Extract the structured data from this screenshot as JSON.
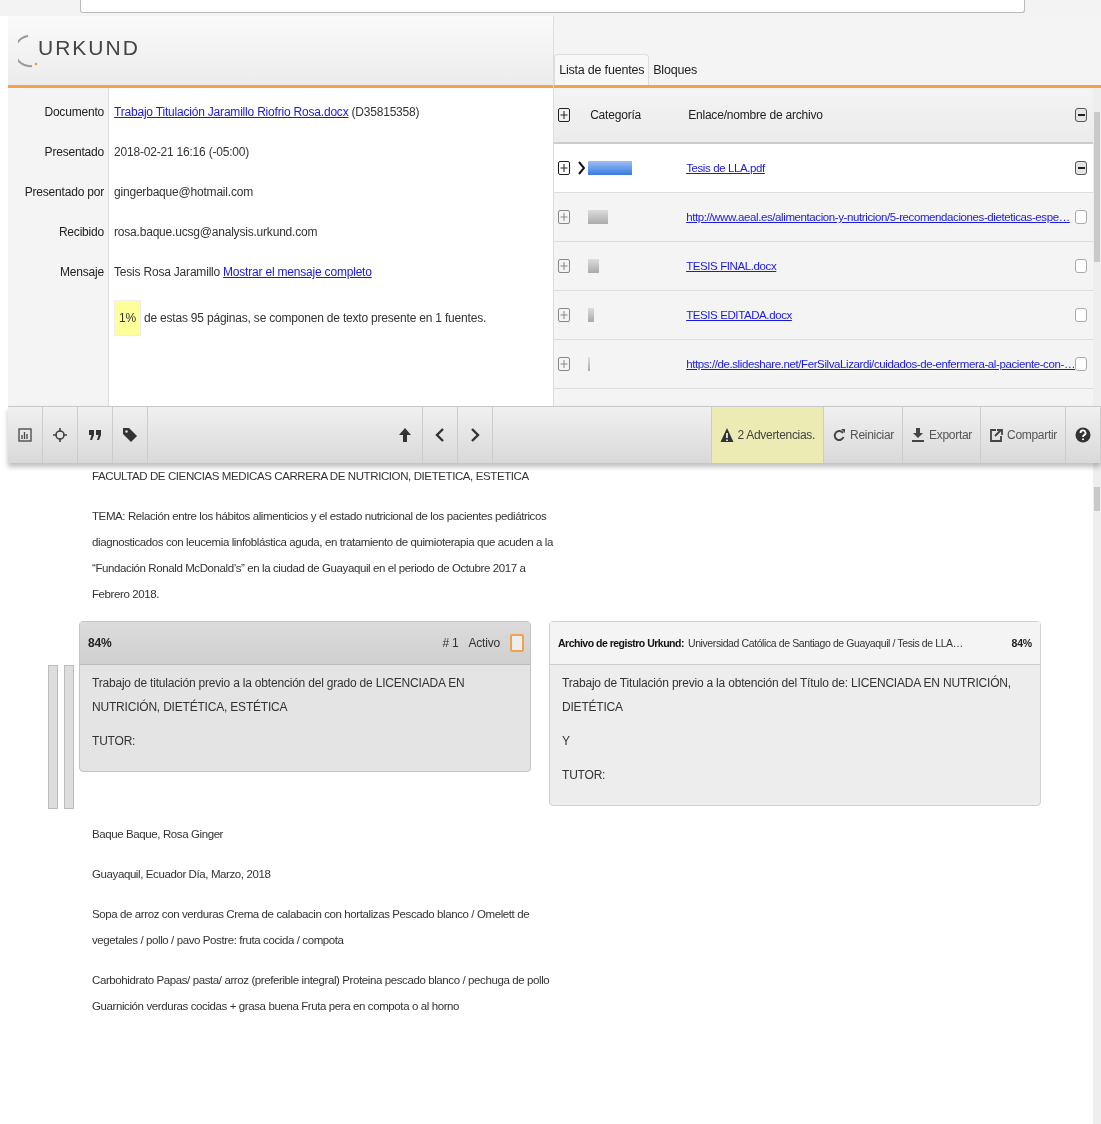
{
  "logo": {
    "text": "URKUND"
  },
  "details": [
    {
      "label": "Documento",
      "kind": "link",
      "value": "Trabajo Titulación Jaramillo Riofrio Rosa.docx",
      "suffix": "(D35815358)"
    },
    {
      "label": "Presentado",
      "kind": "text",
      "value": "2018-02-21 16:16 (-05:00)"
    },
    {
      "label": "Presentado por",
      "kind": "text",
      "value": "gingerbaque@hotmail.com"
    },
    {
      "label": "Recibido",
      "kind": "text",
      "value": "rosa.baque.ucsg@analysis.urkund.com"
    },
    {
      "label": "Mensaje",
      "kind": "message",
      "value": "Tesis Rosa Jaramillo",
      "link": "Mostrar el mensaje completo"
    }
  ],
  "summary": {
    "percent": "1%",
    "text": "de estas 95 páginas, se componen de texto presente en 1 fuentes."
  },
  "tabs": [
    {
      "label": "Lista de fuentes",
      "selected": true
    },
    {
      "label": "Bloques",
      "selected": false
    }
  ],
  "sources": {
    "columns": [
      "Categoría",
      "Enlace/nombre de archivo"
    ],
    "rows": [
      {
        "selected": true,
        "link": "Tesis de LLA.pdf",
        "included": true
      },
      {
        "selected": false,
        "link": "http://www.aeal.es/alimentacion-y-nutricion/5-recomendaciones-dieteticas-espe…",
        "included": false
      },
      {
        "selected": false,
        "link": "TESIS FINAL.docx",
        "included": false
      },
      {
        "selected": false,
        "link": "TESIS EDITADA.docx",
        "included": false
      },
      {
        "selected": false,
        "link": "https://de.slideshare.net/FerSilvaLizardi/cuidados-de-enfermera-al-paciente-con-…",
        "included": false
      }
    ]
  },
  "toolbar": {
    "warnings": "2 Advertencias.",
    "actions": [
      "Reiniciar",
      "Exportar",
      "Compartir"
    ]
  },
  "document": {
    "before": [
      "FACULTAD DE CIENCIAS MEDICAS CARRERA DE NUTRICION, DIETETICA, ESTETICA",
      "TEMA: Relación entre los hábitos alimenticios y el estado nutricional de los pacientes pediátricos diagnosticados con leucemia linfoblástica aguda, en tratamiento de quimioterapia que acuden a la “Fundación Ronald McDonald’s” en la ciudad de Guayaquil en el periodo de Octubre 2017 a Febrero 2018."
    ],
    "match": {
      "percent": "84%",
      "number": "# 1",
      "active_label": "Activo",
      "active": false,
      "text": [
        "Trabajo de titulación previo a la obtención del grado de LICENCIADA EN NUTRICIÓN, DIETÉTICA, ESTÉTICA",
        "TUTOR:"
      ]
    },
    "source_match": {
      "label": "Archivo de registro Urkund:",
      "source": "Universidad Católica de Santiago de Guayaquil / Tesis de LLA…",
      "percent": "84%",
      "text": [
        "Trabajo de Titulación previo a la obtención del Título de: LICENCIADA EN NUTRICIÓN, DIETÉTICA",
        "Y",
        "TUTOR:"
      ]
    },
    "after": [
      "Baque Baque, Rosa Ginger",
      "Guayaquil, Ecuador Día, Marzo, 2018",
      "Sopa de arroz con verduras Crema de calabacin con hortalizas Pescado blanco / Omelett de vegetales / pollo / pavo Postre: fruta cocida / compota",
      "Carbohidrato Papas/ pasta/ arroz (preferible integral) Proteina pescado blanco / pechuga de pollo Guarnición verduras cocidas + grasa buena Fruta pera en compota o al horno"
    ]
  }
}
